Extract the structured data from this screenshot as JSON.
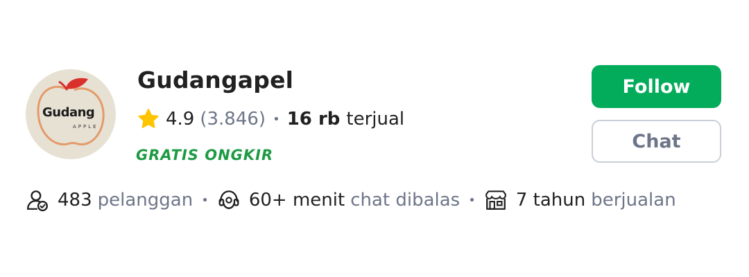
{
  "shop": {
    "name": "Gudangapel",
    "logo_word": "Gudang",
    "logo_sub": "APPLE",
    "rating": "4.9",
    "review_count": "(3.846)",
    "sold_number": "16 rb",
    "sold_label": "terjual",
    "free_shipping": "GRATIS ONGKIR"
  },
  "actions": {
    "follow_label": "Follow",
    "chat_label": "Chat"
  },
  "stats": {
    "subscribers_value": "483",
    "subscribers_label": "pelanggan",
    "chat_reply_value": "60+ menit",
    "chat_reply_label": "chat dibalas",
    "years_value": "7 tahun",
    "years_label": "berjualan"
  },
  "colors": {
    "accent_green": "#03ac5b",
    "free_shipping_green": "#1d9a43",
    "star_yellow": "#ffc400",
    "muted_text": "#6d7588",
    "primary_text": "#212121"
  },
  "icons": {
    "rating": "star-icon",
    "subscribers": "user-check-icon",
    "chat_reply": "headset-icon",
    "years": "store-icon"
  }
}
